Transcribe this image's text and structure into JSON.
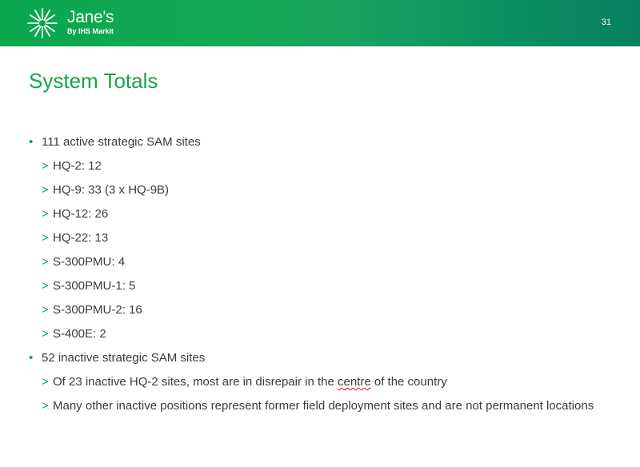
{
  "header": {
    "brand_name": "Jane's",
    "brand_sub": "By IHS Markit",
    "page_number": "31",
    "bg_colors": [
      "#0aa64c",
      "#08805f"
    ]
  },
  "slide": {
    "title": "System Totals",
    "accent_color": "#19a34a",
    "bullets": [
      {
        "text": "111 active strategic SAM sites",
        "sub": [
          "HQ-2:  12",
          "HQ-9:  33 (3 x HQ-9B)",
          "HQ-12:  26",
          "HQ-22:  13",
          "S-300PMU:  4",
          "S-300PMU-1:  5",
          "S-300PMU-2:  16",
          "S-400E:  2"
        ]
      },
      {
        "text": "52 inactive strategic SAM sites",
        "sub_complex": {
          "a_before": "Of 23 inactive HQ-2 sites, most are in disrepair in the ",
          "a_flagged": "centre",
          "a_after": " of the country",
          "b": "Many other inactive positions represent former field deployment sites and are not permanent locations"
        }
      }
    ],
    "bullet_glyph": "•",
    "sub_glyph": ">"
  }
}
